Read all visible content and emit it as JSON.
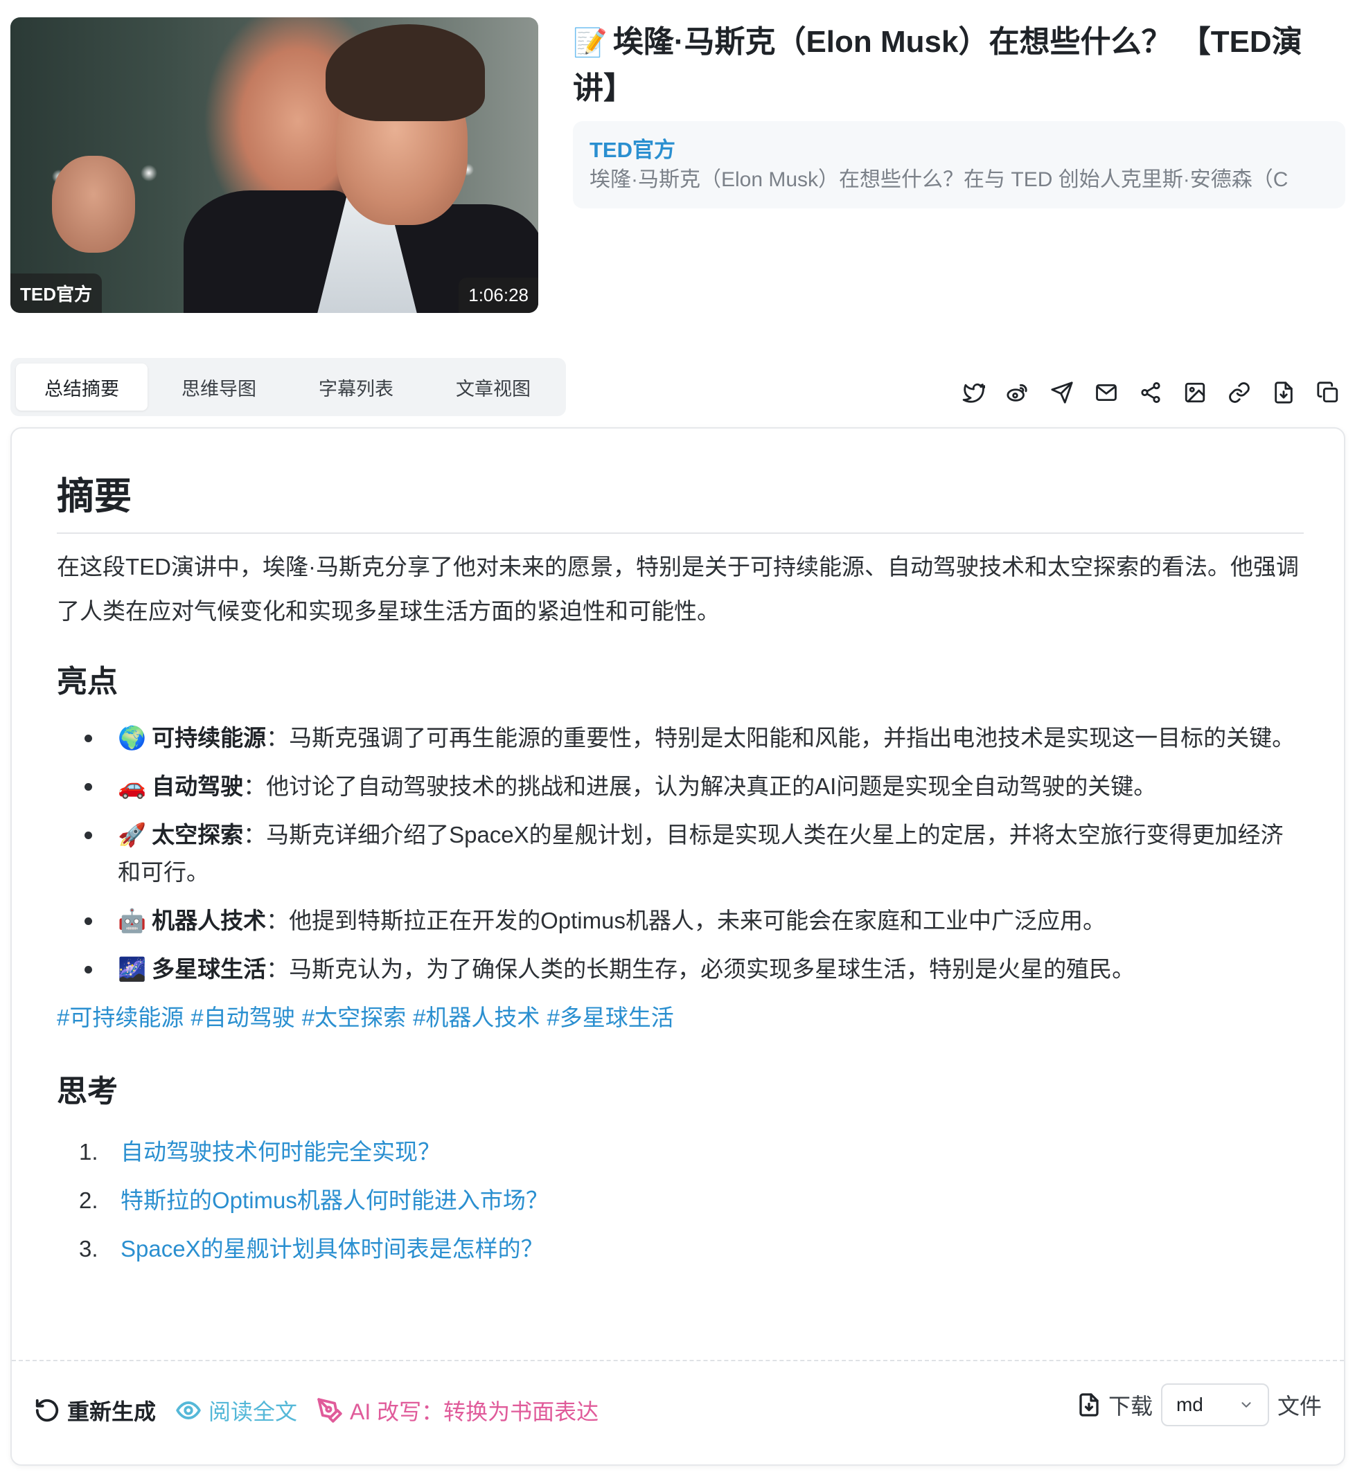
{
  "video": {
    "channel_badge": "TED官方",
    "duration": "1:06:28"
  },
  "header": {
    "title_emoji": "📝",
    "title": "埃隆·马斯克（Elon Musk）在想些什么？ 【TED演讲】",
    "channel_name": "TED官方",
    "description": "埃隆·马斯克（Elon Musk）在想些什么？在与 TED 创始人克里斯·安德森（C"
  },
  "tabs": [
    {
      "label": "总结摘要",
      "active": true
    },
    {
      "label": "思维导图",
      "active": false
    },
    {
      "label": "字幕列表",
      "active": false
    },
    {
      "label": "文章视图",
      "active": false
    }
  ],
  "share_icons": [
    "twitter-icon",
    "weibo-icon",
    "telegram-icon",
    "mail-icon",
    "share-icon",
    "image-icon",
    "link-icon",
    "download-file-icon",
    "copy-icon"
  ],
  "summary": {
    "title": "摘要",
    "text": "在这段TED演讲中，埃隆·马斯克分享了他对未来的愿景，特别是关于可持续能源、自动驾驶技术和太空探索的看法。他强调了人类在应对气候变化和实现多星球生活方面的紧迫性和可能性。"
  },
  "highlights": {
    "title": "亮点",
    "items": [
      {
        "emoji": "🌍",
        "label": "可持续能源",
        "text": "：马斯克强调了可再生能源的重要性，特别是太阳能和风能，并指出电池技术是实现这一目标的关键。"
      },
      {
        "emoji": "🚗",
        "label": "自动驾驶",
        "text": "：他讨论了自动驾驶技术的挑战和进展，认为解决真正的AI问题是实现全自动驾驶的关键。"
      },
      {
        "emoji": "🚀",
        "label": "太空探索",
        "text": "：马斯克详细介绍了SpaceX的星舰计划，目标是实现人类在火星上的定居，并将太空旅行变得更加经济和可行。"
      },
      {
        "emoji": "🤖",
        "label": "机器人技术",
        "text": "：他提到特斯拉正在开发的Optimus机器人，未来可能会在家庭和工业中广泛应用。"
      },
      {
        "emoji": "🌌",
        "label": "多星球生活",
        "text": "：马斯克认为，为了确保人类的长期生存，必须实现多星球生活，特别是火星的殖民。"
      }
    ],
    "tags": [
      "#可持续能源",
      "#自动驾驶",
      "#太空探索",
      "#机器人技术",
      "#多星球生活"
    ]
  },
  "thinking": {
    "title": "思考",
    "questions": [
      {
        "num": "1.",
        "text": "自动驾驶技术何时能完全实现？"
      },
      {
        "num": "2.",
        "text": "特斯拉的Optimus机器人何时能进入市场？"
      },
      {
        "num": "3.",
        "text": "SpaceX的星舰计划具体时间表是怎样的？"
      }
    ]
  },
  "footer": {
    "regenerate": "重新生成",
    "read_full": "阅读全文",
    "ai_rewrite": "AI 改写：转换为书面表达",
    "download": "下载",
    "format_selected": "md",
    "file_suffix": "文件"
  }
}
